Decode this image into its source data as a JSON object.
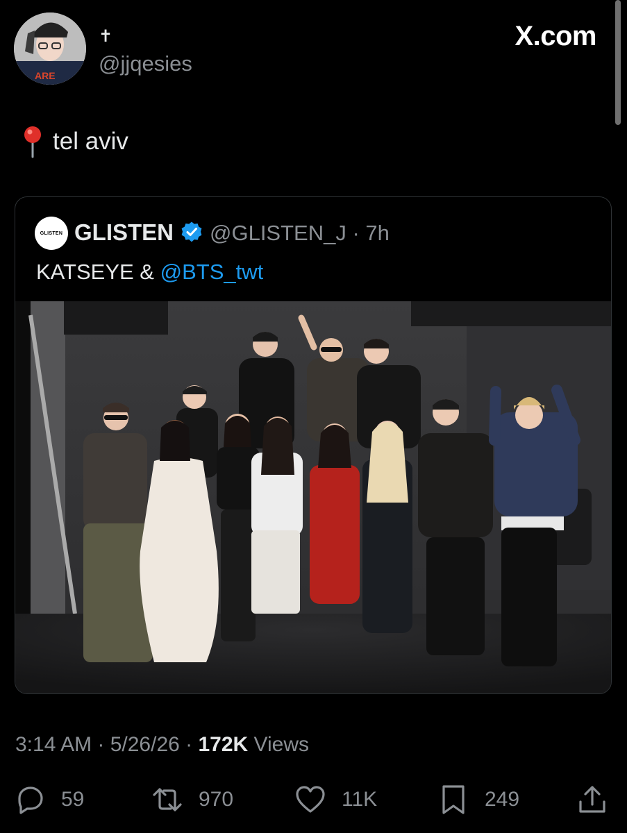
{
  "author": {
    "display_name": "✝",
    "handle": "@jjqesies"
  },
  "brand": {
    "logo_text": "X.com"
  },
  "tweet": {
    "pin_icon": "round-pushpin-icon",
    "text": "tel aviv"
  },
  "quote": {
    "avatar_text": "GLISTEN",
    "name": "GLISTEN",
    "verified_icon": "verified-badge-icon",
    "handle_time": "@GLISTEN_J · 7h",
    "text_prefix": "KATSEYE & ",
    "mention": "@BTS_twt",
    "mention_color": "#1d9bf0"
  },
  "meta": {
    "time_date": "3:14 AM · 5/26/26 · ",
    "views_count": "172K",
    "views_label": " Views"
  },
  "actions": {
    "reply": {
      "icon": "reply-icon",
      "count": "59"
    },
    "retweet": {
      "icon": "retweet-icon",
      "count": "970"
    },
    "like": {
      "icon": "heart-icon",
      "count": "11K"
    },
    "bookmark": {
      "icon": "bookmark-icon",
      "count": "249"
    },
    "share": {
      "icon": "share-icon"
    }
  }
}
